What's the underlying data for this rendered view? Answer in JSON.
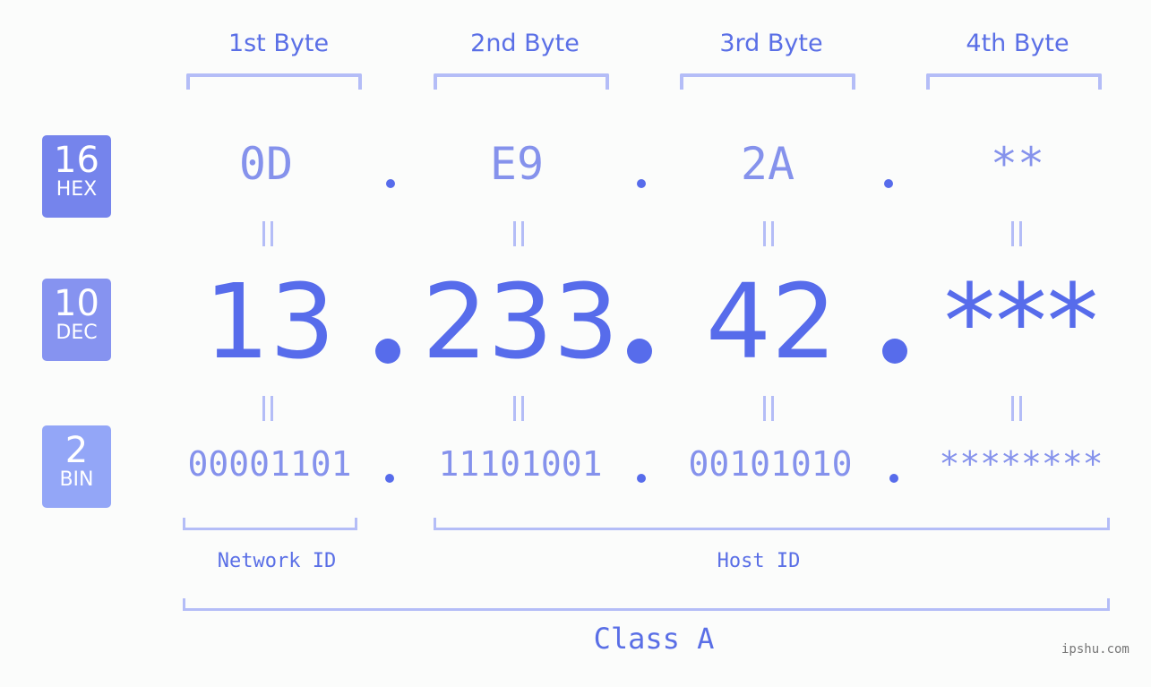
{
  "bytes": {
    "labels": [
      "1st Byte",
      "2nd Byte",
      "3rd Byte",
      "4th Byte"
    ]
  },
  "rows": {
    "hex": {
      "base": "16",
      "name": "HEX",
      "values": [
        "0D",
        "E9",
        "2A",
        "**"
      ],
      "color": "#7584ec"
    },
    "dec": {
      "base": "10",
      "name": "DEC",
      "values": [
        "13",
        "233",
        "42",
        "***"
      ],
      "color": "#8693f0"
    },
    "bin": {
      "base": "2",
      "name": "BIN",
      "values": [
        "00001101",
        "11101001",
        "00101010",
        "********"
      ],
      "color": "#93a6f7"
    }
  },
  "separator": ".",
  "segments": {
    "network": "Network ID",
    "host": "Host ID",
    "class": "Class A"
  },
  "watermark": "ipshu.com",
  "colors": {
    "accent": "#576ceb",
    "light_accent": "#8592ec",
    "bracket": "#b4bdf7",
    "background": "#fbfcfb"
  }
}
